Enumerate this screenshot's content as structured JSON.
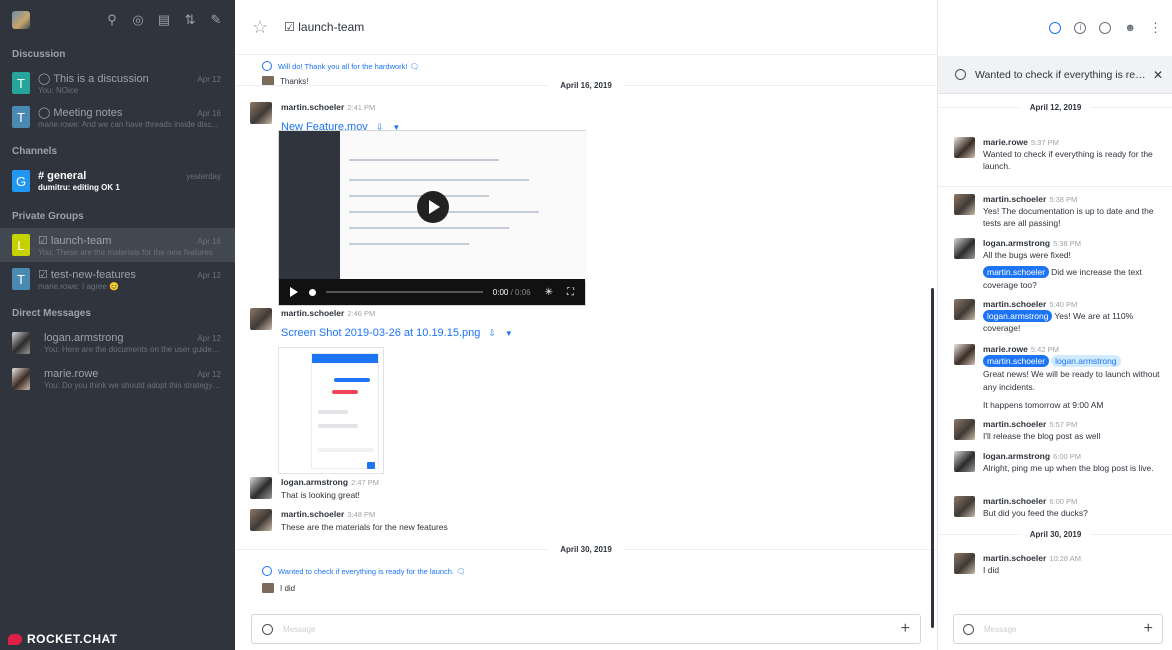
{
  "sidebar": {
    "sections": {
      "discussion": "Discussion",
      "channels": "Channels",
      "private_groups": "Private Groups",
      "direct_messages": "Direct Messages"
    },
    "discussions": [
      {
        "avatar": "T",
        "color": "#26a69a",
        "name": "This is a discussion",
        "date": "Apr 12",
        "sub": "You: NOice"
      },
      {
        "avatar": "T",
        "color": "#4a89b2",
        "name": "Meeting notes",
        "date": "Apr 16",
        "sub": "marie.rowe: And we can have threads inside disc..."
      }
    ],
    "channels": [
      {
        "avatar": "G",
        "color": "#2196f3",
        "name": "general",
        "date": "yesterday",
        "sub": "dumitru: editing OK 1"
      }
    ],
    "private_groups": [
      {
        "avatar": "L",
        "color": "#c6d100",
        "name": "launch-team",
        "date": "Apr 16",
        "sub": "You: These are the materials for the new features"
      },
      {
        "avatar": "T",
        "color": "#4a89b2",
        "name": "test-new-features",
        "date": "Apr 12",
        "sub": "marie.rowe: I agree 😊"
      }
    ],
    "direct_messages": [
      {
        "name": "logan.armstrong",
        "date": "Apr 12",
        "sub": "You: Here are the documents on the user guides ..."
      },
      {
        "name": "marie.rowe",
        "date": "Apr 12",
        "sub": "You: Do you think we should adopt this strategy ..."
      }
    ],
    "brand": "ROCKET.CHAT"
  },
  "main": {
    "room_title": "launch-team",
    "quote_top": "Will do! Thank you all for the hardwork! 🗨",
    "reply_top": "Thanks!",
    "day1": "April 16, 2019",
    "msg1": {
      "user": "martin.schoeler",
      "time": "2:41 PM",
      "file": "New Feature.mov"
    },
    "video": {
      "time": "0:00",
      "duration": "/ 0:06"
    },
    "msg2": {
      "user": "martin.schoeler",
      "time": "2:46 PM",
      "file": "Screen Shot 2019-03-26 at 10.19.15.png"
    },
    "msg3": {
      "user": "logan.armstrong",
      "time": "2:47 PM",
      "text": "That is looking great!"
    },
    "msg4": {
      "user": "martin.schoeler",
      "time": "3:48 PM",
      "text": "These are the materials for the new features"
    },
    "day2": "April 30, 2019",
    "quote_bottom": "Wanted to check if everything is ready for the launch. 🗨",
    "reply_bottom": "I did",
    "composer_placeholder": "Message"
  },
  "thread": {
    "title": "Wanted to check if everything is read...",
    "day1": "April 12, 2019",
    "messages": [
      {
        "user": "marie.rowe",
        "time": "5:37 PM",
        "text": "Wanted to check if everything is ready for the launch."
      },
      {
        "user": "martin.schoeler",
        "time": "5:38 PM",
        "text": "Yes! The documentation is up to date and the tests are all passing!"
      },
      {
        "user": "logan.armstrong",
        "time": "5:38 PM",
        "text": "All the bugs were fixed!",
        "mention": "martin.schoeler",
        "text2": "Did we increase the text coverage too?"
      },
      {
        "user": "martin.schoeler",
        "time": "5:40 PM",
        "mention": "logan.armstrong",
        "text": "Yes! We are at 110% coverage!"
      },
      {
        "user": "marie.rowe",
        "time": "5:42 PM",
        "mention": "martin.schoeler",
        "mention2": "logan.armstrong",
        "text": "Great news! We will be ready to launch without any incidents.",
        "text2": "It happens tomorrow at 9:00 AM"
      },
      {
        "user": "martin.schoeler",
        "time": "5:57 PM",
        "text": "I'll release the blog post as well"
      },
      {
        "user": "logan.armstrong",
        "time": "6:00 PM",
        "text": "Alright, ping me up when the blog post is live."
      },
      {
        "user": "martin.schoeler",
        "time": "6:00 PM",
        "text": "But did you feed the ducks?"
      }
    ],
    "day2": "April 30, 2019",
    "last": {
      "user": "martin.schoeler",
      "time": "10:28 AM",
      "text": "I did"
    },
    "composer_placeholder": "Message"
  },
  "icons": {
    "sidebar_tools": [
      "search-icon",
      "directory-icon",
      "view-mode-icon",
      "sort-icon",
      "create-new-icon"
    ],
    "header": [
      "threads-icon",
      "info-icon",
      "search-icon",
      "members-icon",
      "kebab-icon"
    ]
  },
  "colors": {
    "sidebar_bg": "#2f343d",
    "accent": "#1d74f5",
    "brand_red": "#e01f46"
  }
}
